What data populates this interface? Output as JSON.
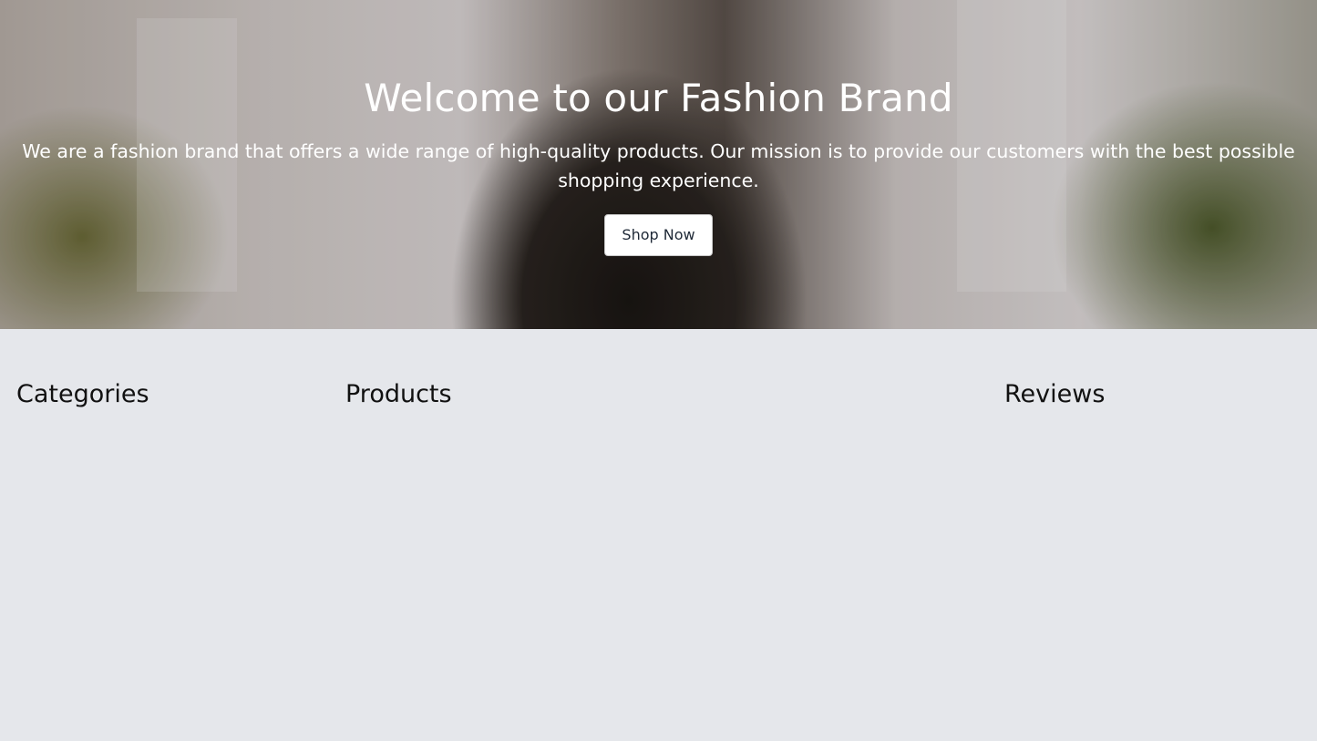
{
  "hero": {
    "title": "Welcome to our Fashion Brand",
    "text": "We are a fashion brand that offers a wide range of high-quality products. Our mission is to provide our customers with the best possible shopping experience.",
    "button_label": "Shop Now"
  },
  "sections": {
    "categories": "Categories",
    "products": "Products",
    "reviews": "Reviews"
  },
  "colors": {
    "page_background": "#e5e7eb",
    "button_background": "#ffffff",
    "button_text": "#1f2937",
    "hero_text": "#ffffff"
  }
}
